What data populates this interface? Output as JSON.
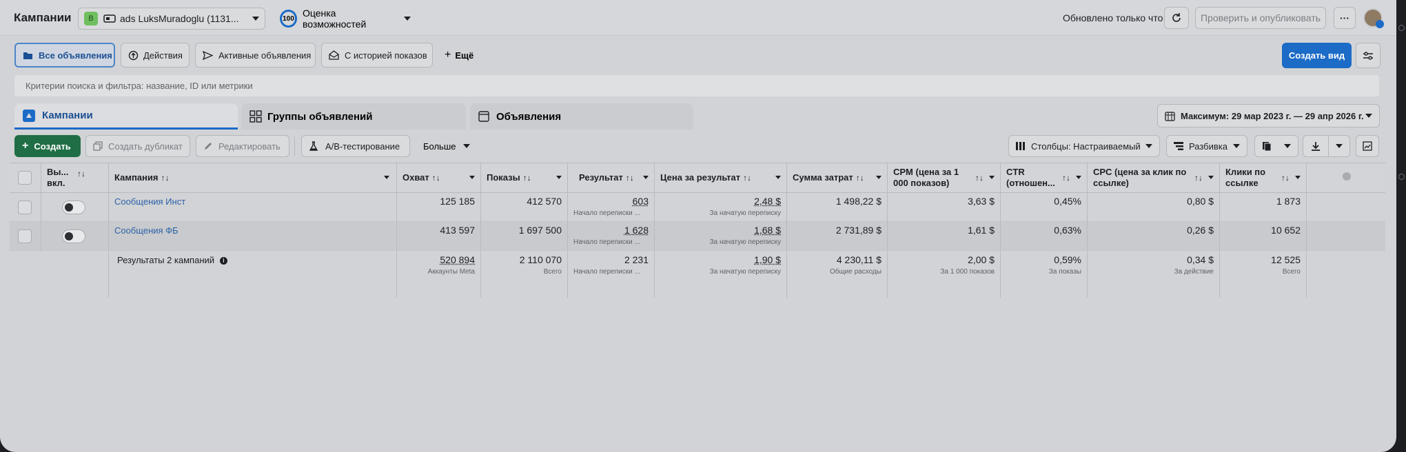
{
  "topbar": {
    "title": "Кампании",
    "account_badge": "B",
    "account_name": "ads LuksMuradoglu (1131...",
    "score_value": "100",
    "score_label": "Оценка возможностей",
    "updated": "Обновлено только что",
    "publish": "Проверить и опубликовать",
    "more": "···"
  },
  "filters": {
    "tabs": [
      "Все объявления",
      "Действия",
      "Активные объявления",
      "С историей показов"
    ],
    "more": "Ещё",
    "create_view": "Создать вид",
    "search_placeholder": "Критерии поиска и фильтра: название, ID или метрики"
  },
  "level_tabs": [
    "Кампании",
    "Группы объявлений",
    "Объявления"
  ],
  "date_range": "Максимум: 29 мар 2023 г. — 29 апр 2026 г.",
  "toolbar": {
    "create": "Создать",
    "duplicate": "Создать дубликат",
    "edit": "Редактировать",
    "ab_test": "A/B-тестирование",
    "more": "Больше",
    "columns": "Столбцы: Настраиваемый",
    "breakdown": "Разбивка"
  },
  "table": {
    "headers": {
      "delivery": "Вы... вкл.",
      "campaign": "Кампания",
      "reach": "Охват",
      "impressions": "Показы",
      "results": "Результат",
      "cost_per_result": "Цена за результат",
      "spend": "Сумма затрат",
      "cpm": "CPM (цена за 1 000 показов)",
      "ctr": "CTR (отношен...",
      "cpc": "CPC (цена за клик по ссылке)",
      "clicks": "Клики по ссылке"
    },
    "rows": [
      {
        "name": "Сообщения Инст",
        "reach": "125 185",
        "impressions": "412 570",
        "results": "603",
        "results_sub": "Начало переписки ...",
        "cost_per_result": "2,48 $",
        "cost_sub": "За начатую переписку",
        "spend": "1 498,22 $",
        "cpm": "3,63 $",
        "ctr": "0,45%",
        "cpc": "0,80 $",
        "clicks": "1 873"
      },
      {
        "name": "Сообщения ФБ",
        "reach": "413 597",
        "impressions": "1 697 500",
        "results": "1 628",
        "results_sub": "Начало переписки ...",
        "cost_per_result": "1,68 $",
        "cost_sub": "За начатую переписку",
        "spend": "2 731,89 $",
        "cpm": "1,61 $",
        "ctr": "0,63%",
        "cpc": "0,26 $",
        "clicks": "10 652"
      }
    ],
    "summary": {
      "label": "Результаты 2 кампаний",
      "reach": "520 894",
      "reach_sub": "Аккаунты Meta",
      "impressions": "2 110 070",
      "impressions_sub": "Всего",
      "results": "2 231",
      "results_sub": "Начало переписки ...",
      "cost_per_result": "1,90 $",
      "cost_sub": "За начатую переписку",
      "spend": "4 230,11 $",
      "spend_sub": "Общие расходы",
      "cpm": "2,00 $",
      "cpm_sub": "За 1 000 показов",
      "ctr": "0,59%",
      "ctr_sub": "За показы",
      "cpc": "0,34 $",
      "cpc_sub": "За действие",
      "clicks": "12 525",
      "clicks_sub": "Всего"
    }
  },
  "colors": {
    "primary": "#1b6bc7",
    "create_green": "#1f6e45",
    "link": "#2b62a8",
    "overlay_bg": "#d2d3d6"
  }
}
